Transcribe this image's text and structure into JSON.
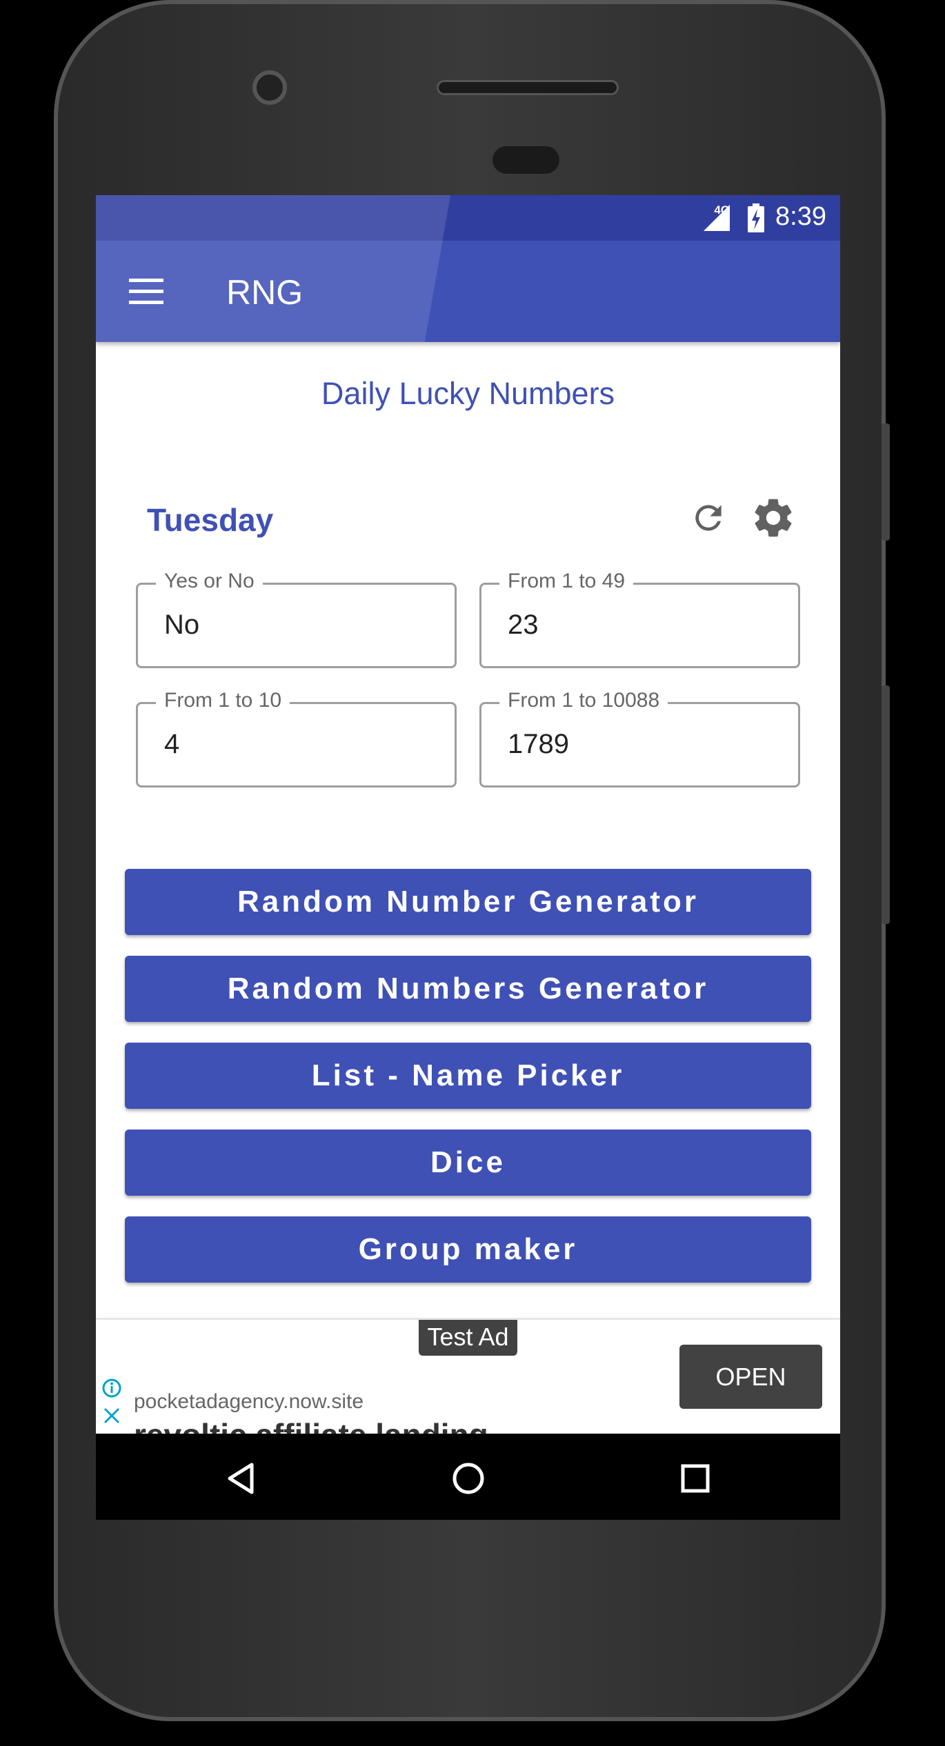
{
  "status_bar": {
    "network": "4G",
    "time": "8:39",
    "icons": [
      "signal-icon",
      "battery-charging-icon"
    ]
  },
  "app_bar": {
    "title": "RNG",
    "menu_icon": "hamburger-menu-icon"
  },
  "main": {
    "heading": "Daily Lucky Numbers",
    "day": "Tuesday",
    "actions": [
      "refresh-icon",
      "gear-icon"
    ],
    "fields": [
      {
        "label": "Yes or No",
        "value": "No"
      },
      {
        "label": "From 1 to 49",
        "value": "23"
      },
      {
        "label": "From 1 to 10",
        "value": "4"
      },
      {
        "label": "From 1 to 10088",
        "value": "1789"
      }
    ],
    "buttons": [
      "Random Number Generator",
      "Random Numbers Generator",
      "List - Name Picker",
      "Dice",
      "Group maker"
    ]
  },
  "ad": {
    "badge": "Test Ad",
    "url": "pocketadagency.now.site",
    "headline": "revoltic affiliate landing",
    "open_label": "OPEN",
    "info_color": "#00a3c8"
  },
  "colors": {
    "primary": "#3f51b5",
    "primary_dark": "#303f9f"
  },
  "nav_bar": {
    "icons": [
      "back-icon",
      "home-icon",
      "recents-icon"
    ]
  }
}
